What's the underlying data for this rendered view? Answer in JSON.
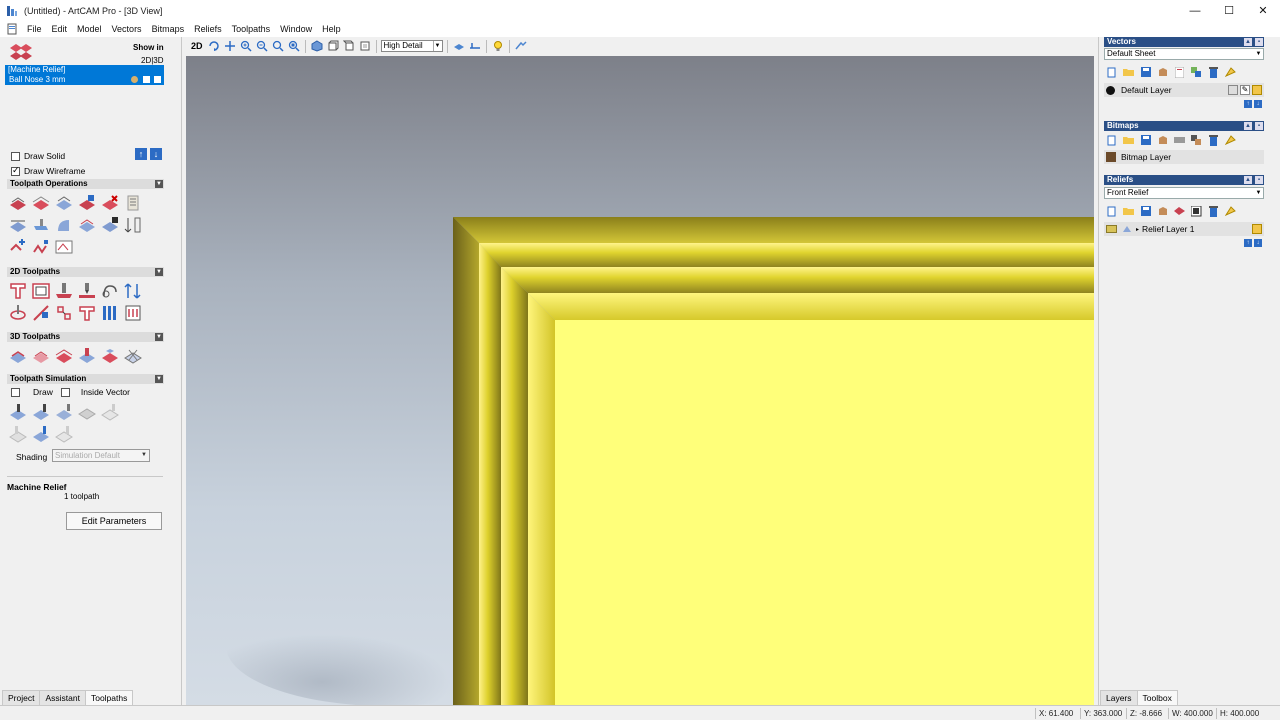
{
  "window": {
    "title": "(Untitled) - ArtCAM Pro - [3D View]",
    "minimize": "—",
    "maximize": "☐",
    "close": "✕"
  },
  "menu": {
    "items": [
      "File",
      "Edit",
      "Model",
      "Vectors",
      "Bitmaps",
      "Reliefs",
      "Toolpaths",
      "Window",
      "Help"
    ]
  },
  "left": {
    "show_in_label": "Show in",
    "show_in_value": "2D|3D",
    "toolpath_list": {
      "name": "[Machine Relief]",
      "tool": "Ball Nose 3 mm"
    },
    "draw_solid": "Draw Solid",
    "draw_wireframe": "Draw Wireframe",
    "draw_solid_checked": false,
    "draw_wireframe_checked": true,
    "sections": {
      "toolpath_operations": "Toolpath Operations",
      "toolpaths_2d": "2D Toolpaths",
      "toolpaths_3d": "3D Toolpaths",
      "toolpath_simulation": "Toolpath Simulation"
    },
    "sim_draw": "Draw",
    "sim_inside_vector": "Inside Vector",
    "shading_label": "Shading",
    "shading_value": "Simulation Default",
    "selected_name": "Machine Relief",
    "selected_count": "1 toolpath",
    "edit_button": "Edit Parameters",
    "tabs": [
      "Project",
      "Assistant",
      "Toolpaths"
    ],
    "active_tab": "Toolpaths"
  },
  "toolbar": {
    "mode_2d": "2D",
    "detail_value": "High Detail"
  },
  "right": {
    "vectors": {
      "header": "Vectors",
      "sheet": "Default Sheet",
      "layer": "Default Layer"
    },
    "bitmaps": {
      "header": "Bitmaps",
      "layer": "Bitmap Layer"
    },
    "reliefs": {
      "header": "Reliefs",
      "relief": "Front Relief",
      "layer": "Relief Layer 1"
    },
    "tabs": [
      "Layers",
      "Toolbox"
    ],
    "active_tab": "Toolbox"
  },
  "status": {
    "x": "X: 61.400",
    "y": "Y: 363.000",
    "z": "Z: -8.666",
    "w": "W: 400.000",
    "h": "H: 400.000"
  },
  "colors": {
    "accent_header": "#2a4f86",
    "selection": "#0078d7",
    "relief_gold": "#ffff7a"
  }
}
